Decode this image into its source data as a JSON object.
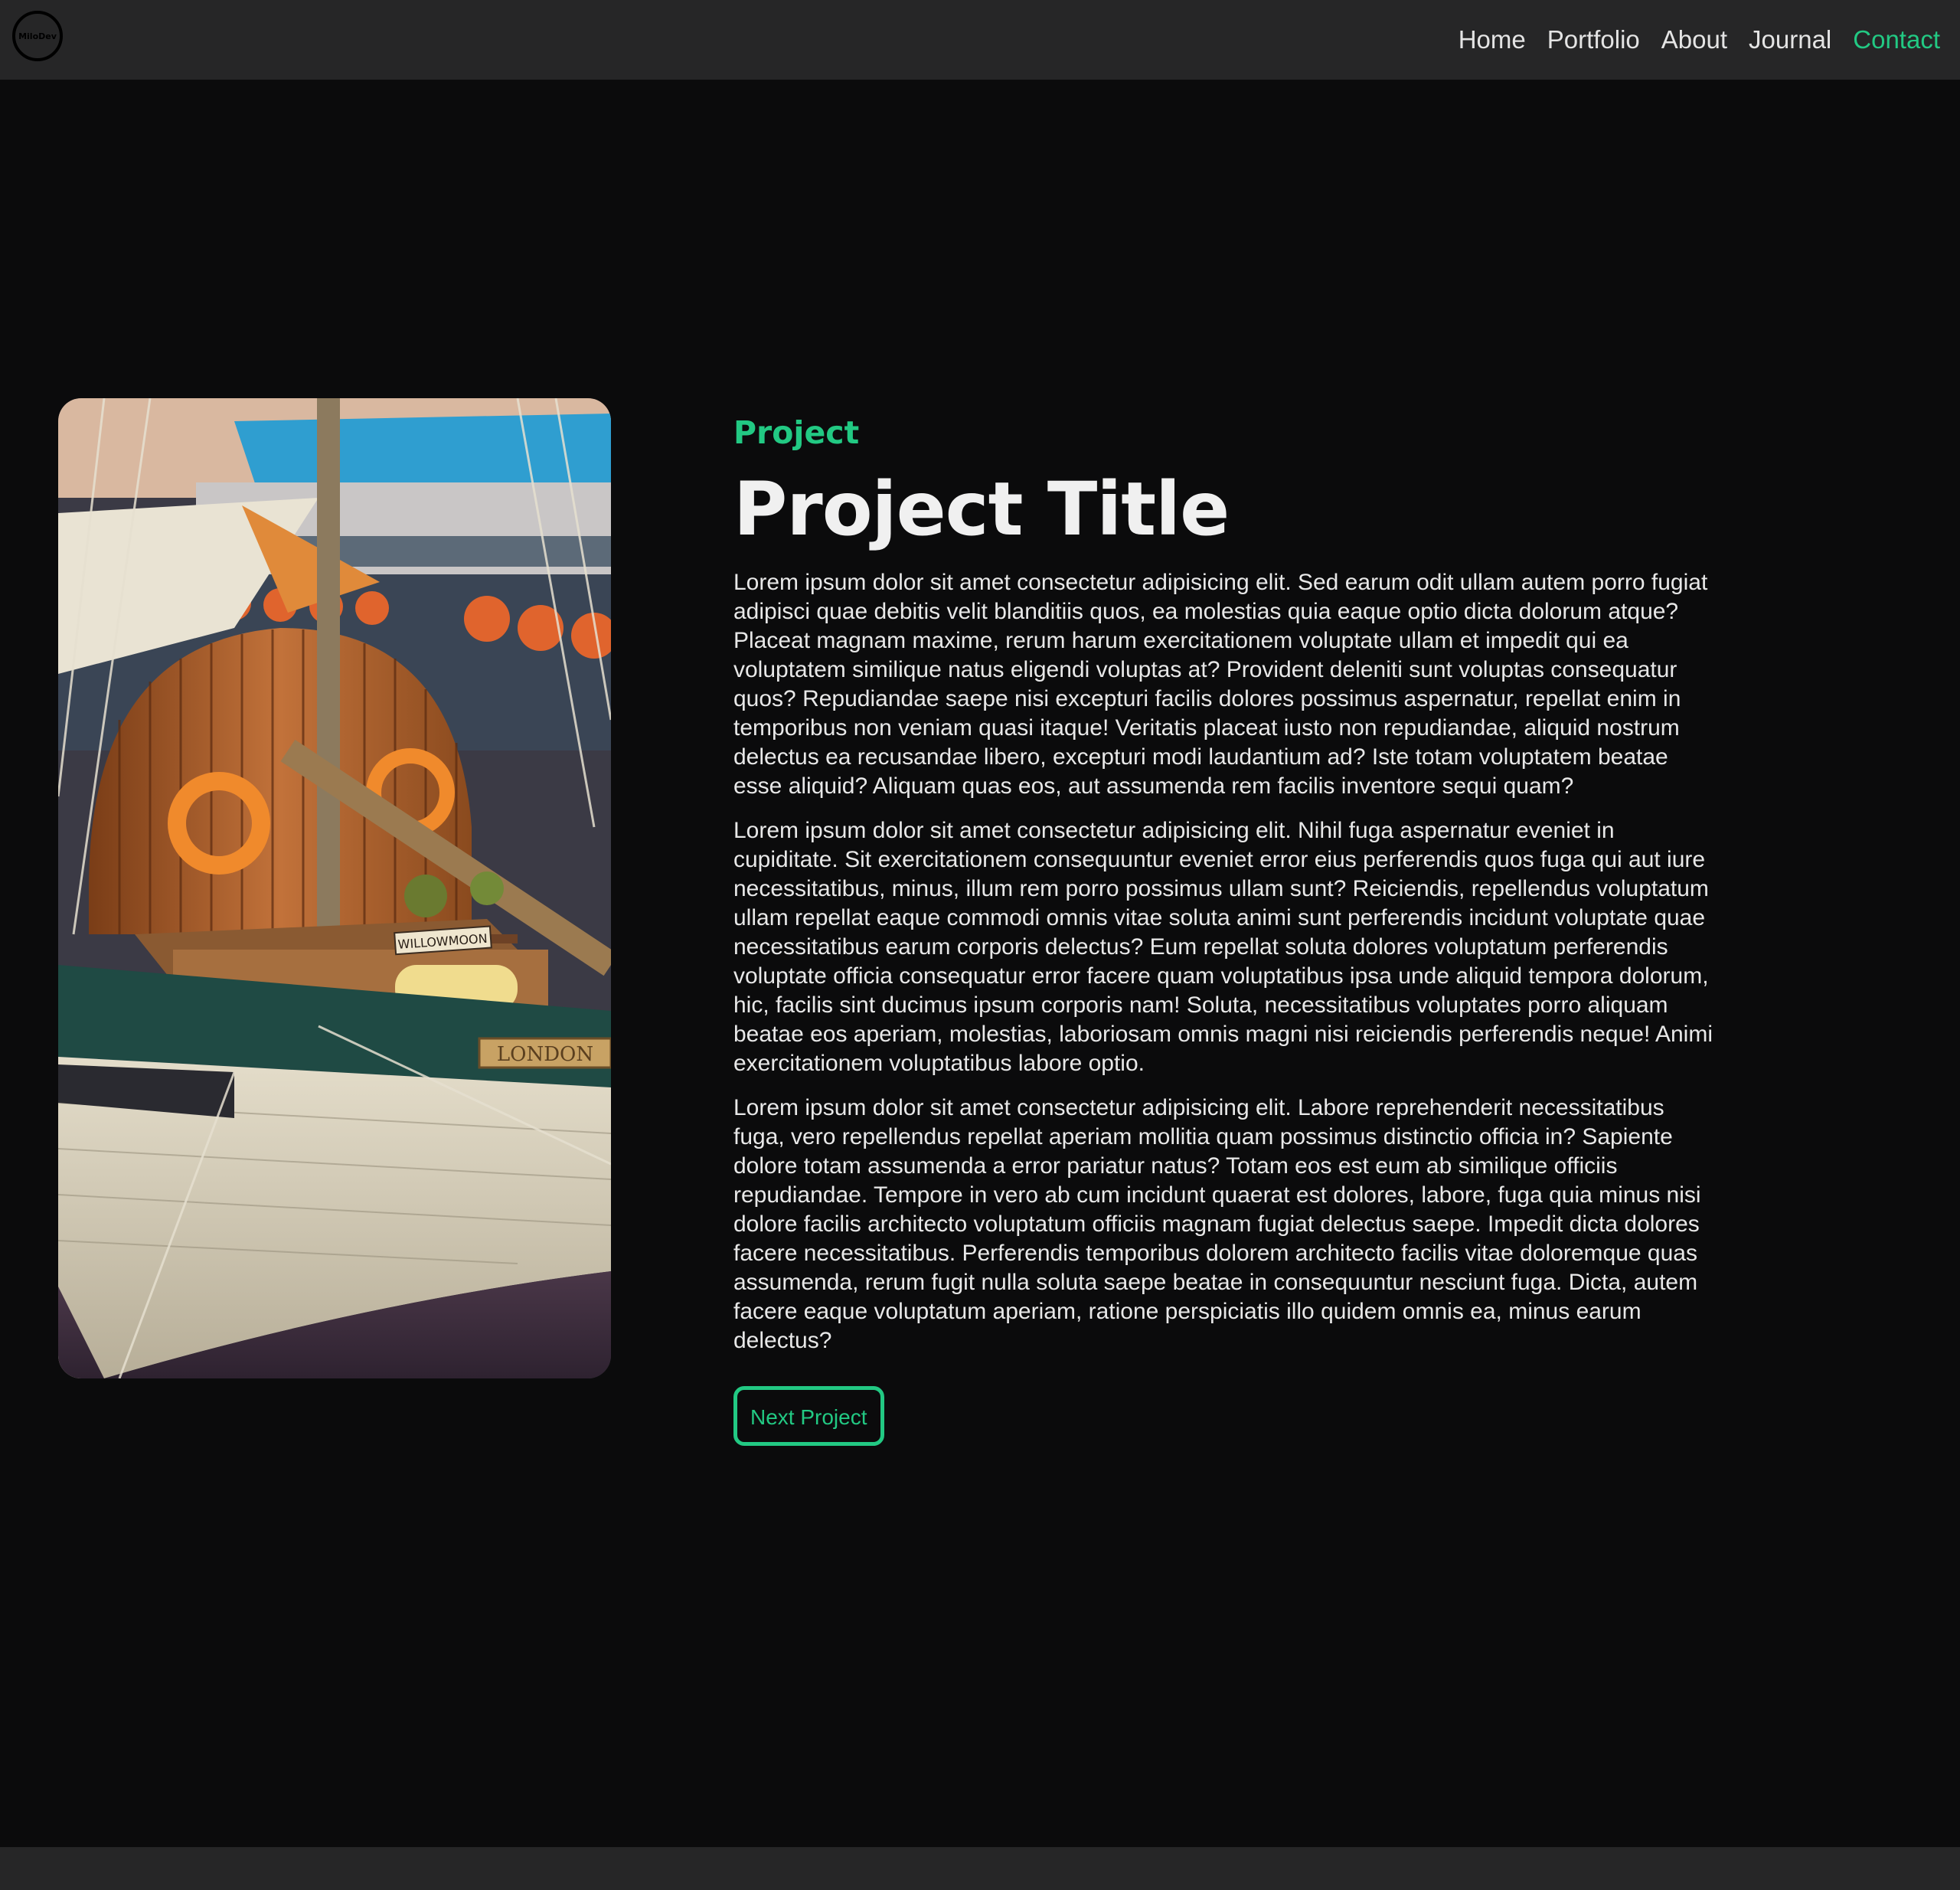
{
  "header": {
    "logo_text": "MiloDev",
    "nav": [
      {
        "label": "Home"
      },
      {
        "label": "Portfolio"
      },
      {
        "label": "About"
      },
      {
        "label": "Journal"
      },
      {
        "label": "Contact",
        "active": true
      }
    ]
  },
  "project": {
    "eyebrow": "Project",
    "title": "Project Title",
    "image_labels": {
      "nameboard": "WILLOWMOON",
      "port": "LONDON"
    },
    "paragraphs": [
      "Lorem ipsum dolor sit amet consectetur adipisicing elit. Sed earum odit ullam autem porro fugiat adipisci quae debitis velit blanditiis quos, ea molestias quia eaque optio dicta dolorum atque? Placeat magnam maxime, rerum harum exercitationem voluptate ullam et impedit qui ea voluptatem similique natus eligendi voluptas at? Provident deleniti sunt voluptas consequatur quos? Repudiandae saepe nisi excepturi facilis dolores possimus aspernatur, repellat enim in temporibus non veniam quasi itaque! Veritatis placeat iusto non repudiandae, aliquid nostrum delectus ea recusandae libero, excepturi modi laudantium ad? Iste totam voluptatem beatae esse aliquid? Aliquam quas eos, aut assumenda rem facilis inventore sequi quam?",
      "Lorem ipsum dolor sit amet consectetur adipisicing elit. Nihil fuga aspernatur eveniet in cupiditate. Sit exercitationem consequuntur eveniet error eius perferendis quos fuga qui aut iure necessitatibus, minus, illum rem porro possimus ullam sunt? Reiciendis, repellendus voluptatum ullam repellat eaque commodi omnis vitae soluta animi sunt perferendis incidunt voluptate quae necessitatibus earum corporis delectus? Eum repellat soluta dolores voluptatum perferendis voluptate officia consequatur error facere quam voluptatibus ipsa unde aliquid tempora dolorum, hic, facilis sint ducimus ipsum corporis nam! Soluta, necessitatibus voluptates porro aliquam beatae eos aperiam, molestias, laboriosam omnis magni nisi reiciendis perferendis neque! Animi exercitationem voluptatibus labore optio.",
      "Lorem ipsum dolor sit amet consectetur adipisicing elit. Labore reprehenderit necessitatibus fuga, vero repellendus repellat aperiam mollitia quam possimus distinctio officia in? Sapiente dolore totam assumenda a error pariatur natus? Totam eos est eum ab similique officiis repudiandae. Tempore in vero ab cum incidunt quaerat est dolores, labore, fuga quia minus nisi dolore facilis architecto voluptatum officiis magnam fugiat delectus saepe. Impedit dicta dolores facere necessitatibus. Perferendis temporibus dolorem architecto facilis vitae doloremque quas assumenda, rerum fugit nulla soluta saepe beatae in consequuntur nesciunt fuga. Dicta, autem facere eaque voluptatum aperiam, ratione perspiciatis illo quidem omnis ea, minus earum delectus?"
    ],
    "next_button": "Next Project"
  },
  "colors": {
    "accent": "#22c983",
    "background": "#0b0b0c",
    "navbar": "#262627"
  }
}
